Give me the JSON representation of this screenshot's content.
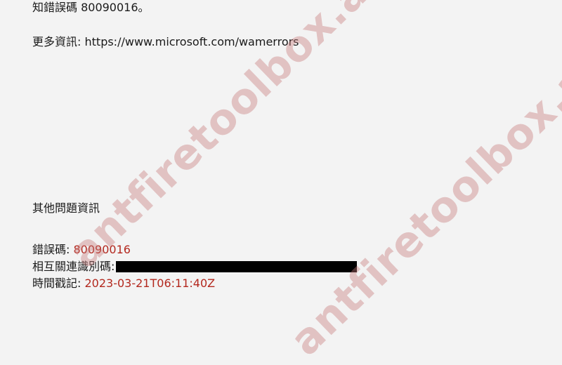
{
  "error_details": {
    "known_error_line": "知錯誤碼 80090016。",
    "more_info_label": "更多資訊:",
    "more_info_url": "https://www.microsoft.com/wamerrors"
  },
  "additional_info": {
    "heading": "其他問題資訊",
    "error_code_label": "錯誤碼:",
    "error_code_value": "80090016",
    "correlation_id_label": "相互關連識別碼:",
    "timestamp_label": "時間戳記:",
    "timestamp_value": "2023-03-21T06:11:40Z"
  },
  "colors": {
    "background": "#f3f3f3",
    "text": "#1a1a1a",
    "value_red": "#b3281e",
    "watermark": "#c67878"
  },
  "watermark": {
    "text_primary": "antfiretoolbox.app",
    "text_secondary": "antfiretoolbox.app"
  }
}
